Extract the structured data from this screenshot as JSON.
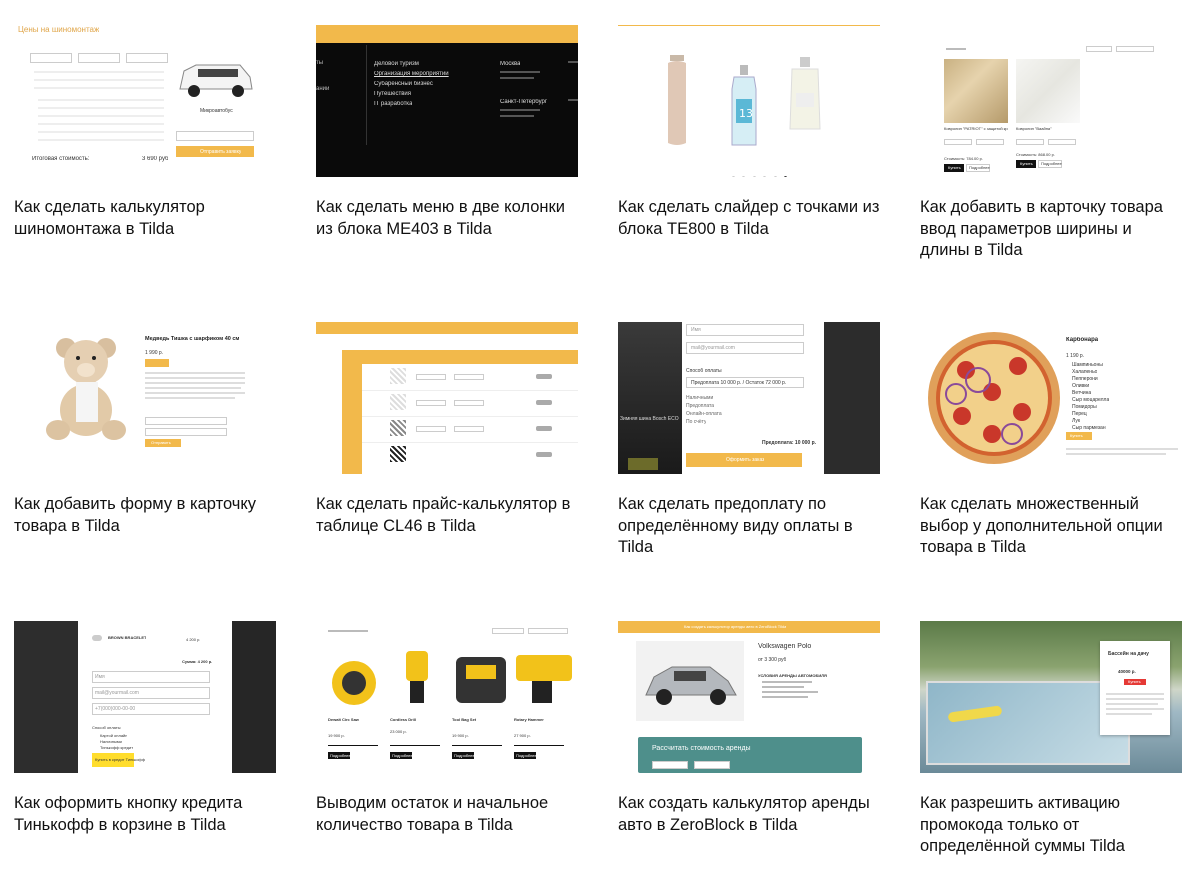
{
  "colors": {
    "accent": "#f2b94b",
    "dark": "#0e0e0e",
    "text": "#111111"
  },
  "cards": [
    {
      "title": "Как сделать калькулятор шиномонтажа в Tilda",
      "thumb": {
        "heading": "Цены на шиномонтаж",
        "total_label": "Итоговая стоимость:",
        "total": "3 690 руб",
        "button": "Отправить заявку",
        "vehicle": "Микроавтобус"
      }
    },
    {
      "title": "Как сделать меню в две колонки из блока ME403 в Tilda",
      "thumb": {
        "menu": [
          "Деловой туризм",
          "Организация мероприятий",
          "Субаренсный бизнес",
          "Путешествия",
          "IT разработка"
        ],
        "city1": "Москва",
        "city2": "Санкт-Петербург",
        "left_items": [
          "ты",
          "ании"
        ]
      }
    },
    {
      "title": "Как сделать слайдер с точками из блока TE800 в Tilda",
      "thumb": {
        "product_label": "13"
      }
    },
    {
      "title": "Как добавить в карточку товара ввод параметров ширины и длины в Tilda",
      "thumb": {
        "product1": "Ковролин \"PATRIOT\" с защитой кромкой",
        "product2": "Ковролин \"Ваайна\"",
        "price1": "Стоимость: 784.00 р.",
        "price2": "Стоимость: 868.00 р.",
        "buy": "Купить",
        "more": "Подробнее"
      }
    },
    {
      "title": "Как добавить форму в карточку товара в Tilda",
      "thumb": {
        "product": "Медведь Тишка с шарфиком 40 см",
        "price": "1 990 р.",
        "button": "Отправить"
      }
    },
    {
      "title": "Как сделать прайс-калькулятор в таблице CL46 в Tilda",
      "thumb": {
        "row_button": "Рассчитать"
      }
    },
    {
      "title": "Как сделать предоплату по определённому виду оплаты в Tilda",
      "thumb": {
        "name_ph": "Имя",
        "email_ph": "mail@yourmail.com",
        "pay_label": "Способ оплаты",
        "select_value": "Предоплата 10 000 р. / Остаток 72 000 р.",
        "options": [
          "Наличными",
          "Предоплата",
          "Онлайн-оплата",
          "По счёту"
        ],
        "prepay": "Предоплата: 10 000 р.",
        "button": "Оформить заказ",
        "product": "Зимняя шина Bosch ECO"
      }
    },
    {
      "title": "Как сделать множественный выбор у дополнительной опции товара в Tilda",
      "thumb": {
        "product": "Карбонара",
        "price": "1 190 р.",
        "options": [
          "Шампиньоны",
          "Халапеньо",
          "Пепперони",
          "Оливки",
          "Ветчина",
          "Сыр моцарелла",
          "Помидоры",
          "Перец",
          "Лук",
          "Сыр пармезан"
        ],
        "button": "Купить"
      }
    },
    {
      "title": "Как оформить кнопку кредита Тинькофф в корзине в Tilda",
      "thumb": {
        "product": "BROWN BRACELET",
        "price": "4 200 р.",
        "sum": "Сумма: 4 200 р.",
        "fields": [
          "Имя",
          "mail@yourmail.com",
          "+7(000)000-00-00"
        ],
        "pay_label": "Способ оплаты",
        "options": [
          "Картой онлайн",
          "Наличными",
          "Тинькофф кредит"
        ],
        "credit_button": "Купить в кредит Тинькофф"
      }
    },
    {
      "title": "Выводим остаток и начальное количество товара в Tilda",
      "thumb": {
        "products": [
          "Dewalt Circ Saw",
          "Cordless Drill",
          "Tool Bag Set",
          "Rotary Hammer"
        ],
        "prices": [
          "19 900 р.",
          "23 000 р.",
          "19 900 р.",
          "27 900 р."
        ],
        "more": "Подробнее"
      }
    },
    {
      "title": "Как создать калькулятор аренды авто в ZeroBlock в Tilda",
      "thumb": {
        "banner": "Как создать калькулятор аренды авто в ZeroBlock Tilda",
        "car": "Volkswagen Polo",
        "price": "от 3 300 руб",
        "features_title": "УСЛОВИЯ АРЕНДЫ АВТОМОБИЛЯ",
        "calc": "Рассчитать стоимость аренды"
      }
    },
    {
      "title": "Как разрешить активацию промокода только от определённой суммы Tilda",
      "thumb": {
        "product": "Бассейн на дачу",
        "price": "40000 р.",
        "button": "Купить"
      }
    }
  ]
}
